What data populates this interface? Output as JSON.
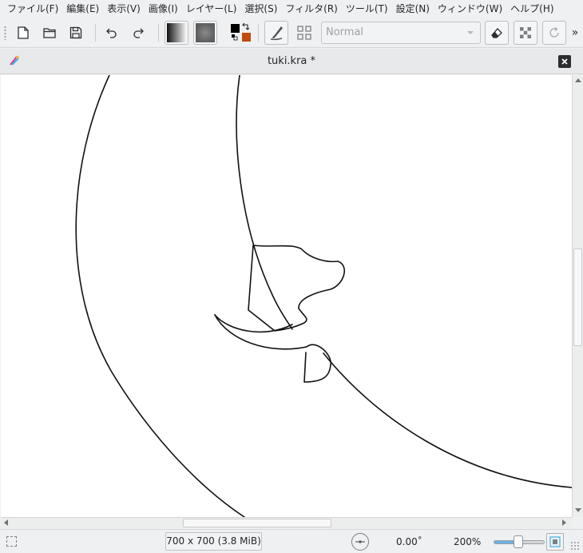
{
  "menubar": {
    "items": [
      "ファイル(F)",
      "編集(E)",
      "表示(V)",
      "画像(I)",
      "レイヤー(L)",
      "選択(S)",
      "フィルタ(R)",
      "ツール(T)",
      "設定(N)",
      "ウィンドウ(W)",
      "ヘルプ(H)"
    ]
  },
  "toolbar": {
    "blend_mode": "Normal",
    "overflow_glyph": "»",
    "icons": [
      "new-document-icon",
      "open-folder-icon",
      "save-icon",
      "undo-icon",
      "redo-icon",
      "gradient-icon",
      "pattern-icon",
      "color-swap-icon",
      "brush-preset-icon",
      "settings-grid-icon",
      "eraser-icon",
      "alpha-lock-icon",
      "reload-preset-icon"
    ],
    "foreground_color": "#000000",
    "background_color": "#c24a0e"
  },
  "document": {
    "title": "tuki.kra *"
  },
  "status": {
    "image_size": "700 x 700 (3.8 MiB)",
    "rotation": "0.00˚",
    "zoom": "200%",
    "zoom_slider_fraction": 0.48
  },
  "colors": {
    "accent": "#3daee9",
    "canvas": "#ffffff",
    "chrome": "#eff0f1"
  }
}
